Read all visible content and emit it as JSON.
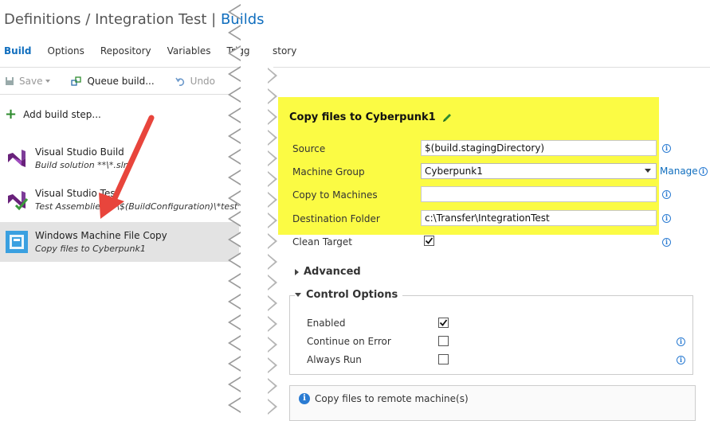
{
  "breadcrumb": {
    "part1": "Definitions",
    "sep1": " / ",
    "part2": "Integration Test",
    "sep2": " | ",
    "part3": "Builds"
  },
  "tabs": {
    "build": "Build",
    "options": "Options",
    "repository": "Repository",
    "variables": "Variables",
    "triggers": "Trigg",
    "history": "story"
  },
  "toolbar": {
    "save": "Save",
    "queue": "Queue build...",
    "undo": "Undo"
  },
  "add_step": "Add build step...",
  "steps": [
    {
      "title": "Visual Studio Build",
      "subtitle": "Build solution **\\*.sln"
    },
    {
      "title": "Visual Studio Tes",
      "subtitle": "Test Assemblies **\\$(BuildConfiguration)\\*test*.d"
    },
    {
      "title": "Windows Machine File Copy",
      "subtitle": "Copy files to Cyberpunk1"
    }
  ],
  "panel": {
    "title": "Copy files to Cyberpunk1",
    "fields": {
      "source_label": "Source",
      "source_value": "$(build.stagingDirectory)",
      "machine_group_label": "Machine Group",
      "machine_group_value": "Cyberpunk1",
      "copy_to_label": "Copy to Machines",
      "copy_to_value": "",
      "dest_label": "Destination Folder",
      "dest_value": "c:\\Transfer\\IntegrationTest",
      "clean_label": "Clean Target"
    },
    "manage": "Manage",
    "advanced": "Advanced",
    "control_options": "Control Options",
    "enabled": "Enabled",
    "continue_on_error": "Continue on Error",
    "always_run": "Always Run",
    "info_text": "Copy files to remote machine(s)"
  },
  "colors": {
    "link": "#106ebe",
    "highlight": "#fbfb44",
    "arrow": "#e8453c"
  }
}
